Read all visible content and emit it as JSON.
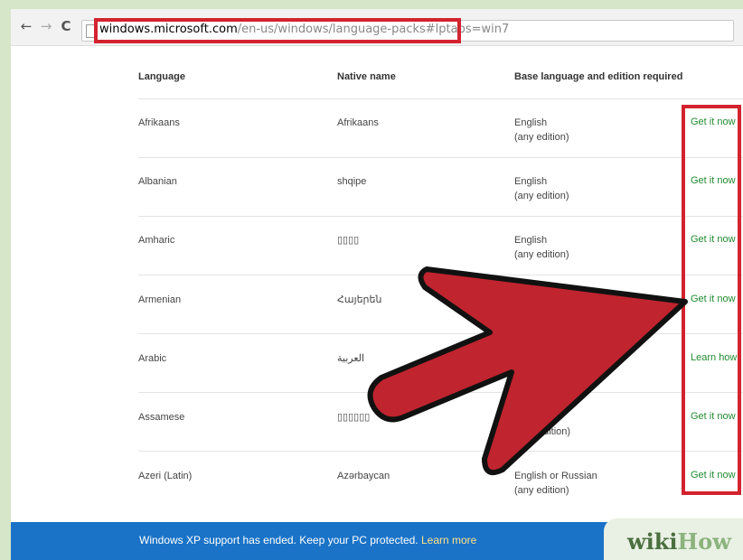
{
  "browser": {
    "back_glyph": "←",
    "forward_glyph": "→",
    "reload_glyph": "C",
    "url_host": "windows.microsoft.com",
    "url_path": "/en-us/windows/language-packs#lptabs=win7"
  },
  "table": {
    "headers": [
      "Language",
      "Native name",
      "Base language and edition required"
    ],
    "rows": [
      {
        "language": "Afrikaans",
        "native": "Afrikaans",
        "base": "English",
        "edition": "(any edition)",
        "action": "Get it now"
      },
      {
        "language": "Albanian",
        "native": "shqipe",
        "base": "English",
        "edition": "(any edition)",
        "action": "Get it now"
      },
      {
        "language": "Amharic",
        "native": "▯▯▯▯",
        "base": "English",
        "edition": "(any edition)",
        "action": "Get it now"
      },
      {
        "language": "Armenian",
        "native": "Հայերեն",
        "base": "",
        "edition": "",
        "action": "Get it now"
      },
      {
        "language": "Arabic",
        "native": "العربية",
        "base": "",
        "edition": "",
        "action": "Learn how"
      },
      {
        "language": "Assamese",
        "native": "▯▯▯▯▯▯",
        "base": "",
        "edition": "edition)",
        "action": "Get it now"
      },
      {
        "language": "Azeri (Latin)",
        "native": "Azərbaycan",
        "base": "English or Russian",
        "edition": "(any edition)",
        "action": "Get it now"
      }
    ]
  },
  "banner": {
    "text": "Windows XP support has ended. Keep your PC protected.",
    "link": "Learn more"
  },
  "watermark": {
    "part1": "wiki",
    "part2": "How"
  },
  "colors": {
    "highlight": "#d3232f",
    "action_green": "#1f8a2f",
    "banner_blue": "#1a73c7"
  }
}
